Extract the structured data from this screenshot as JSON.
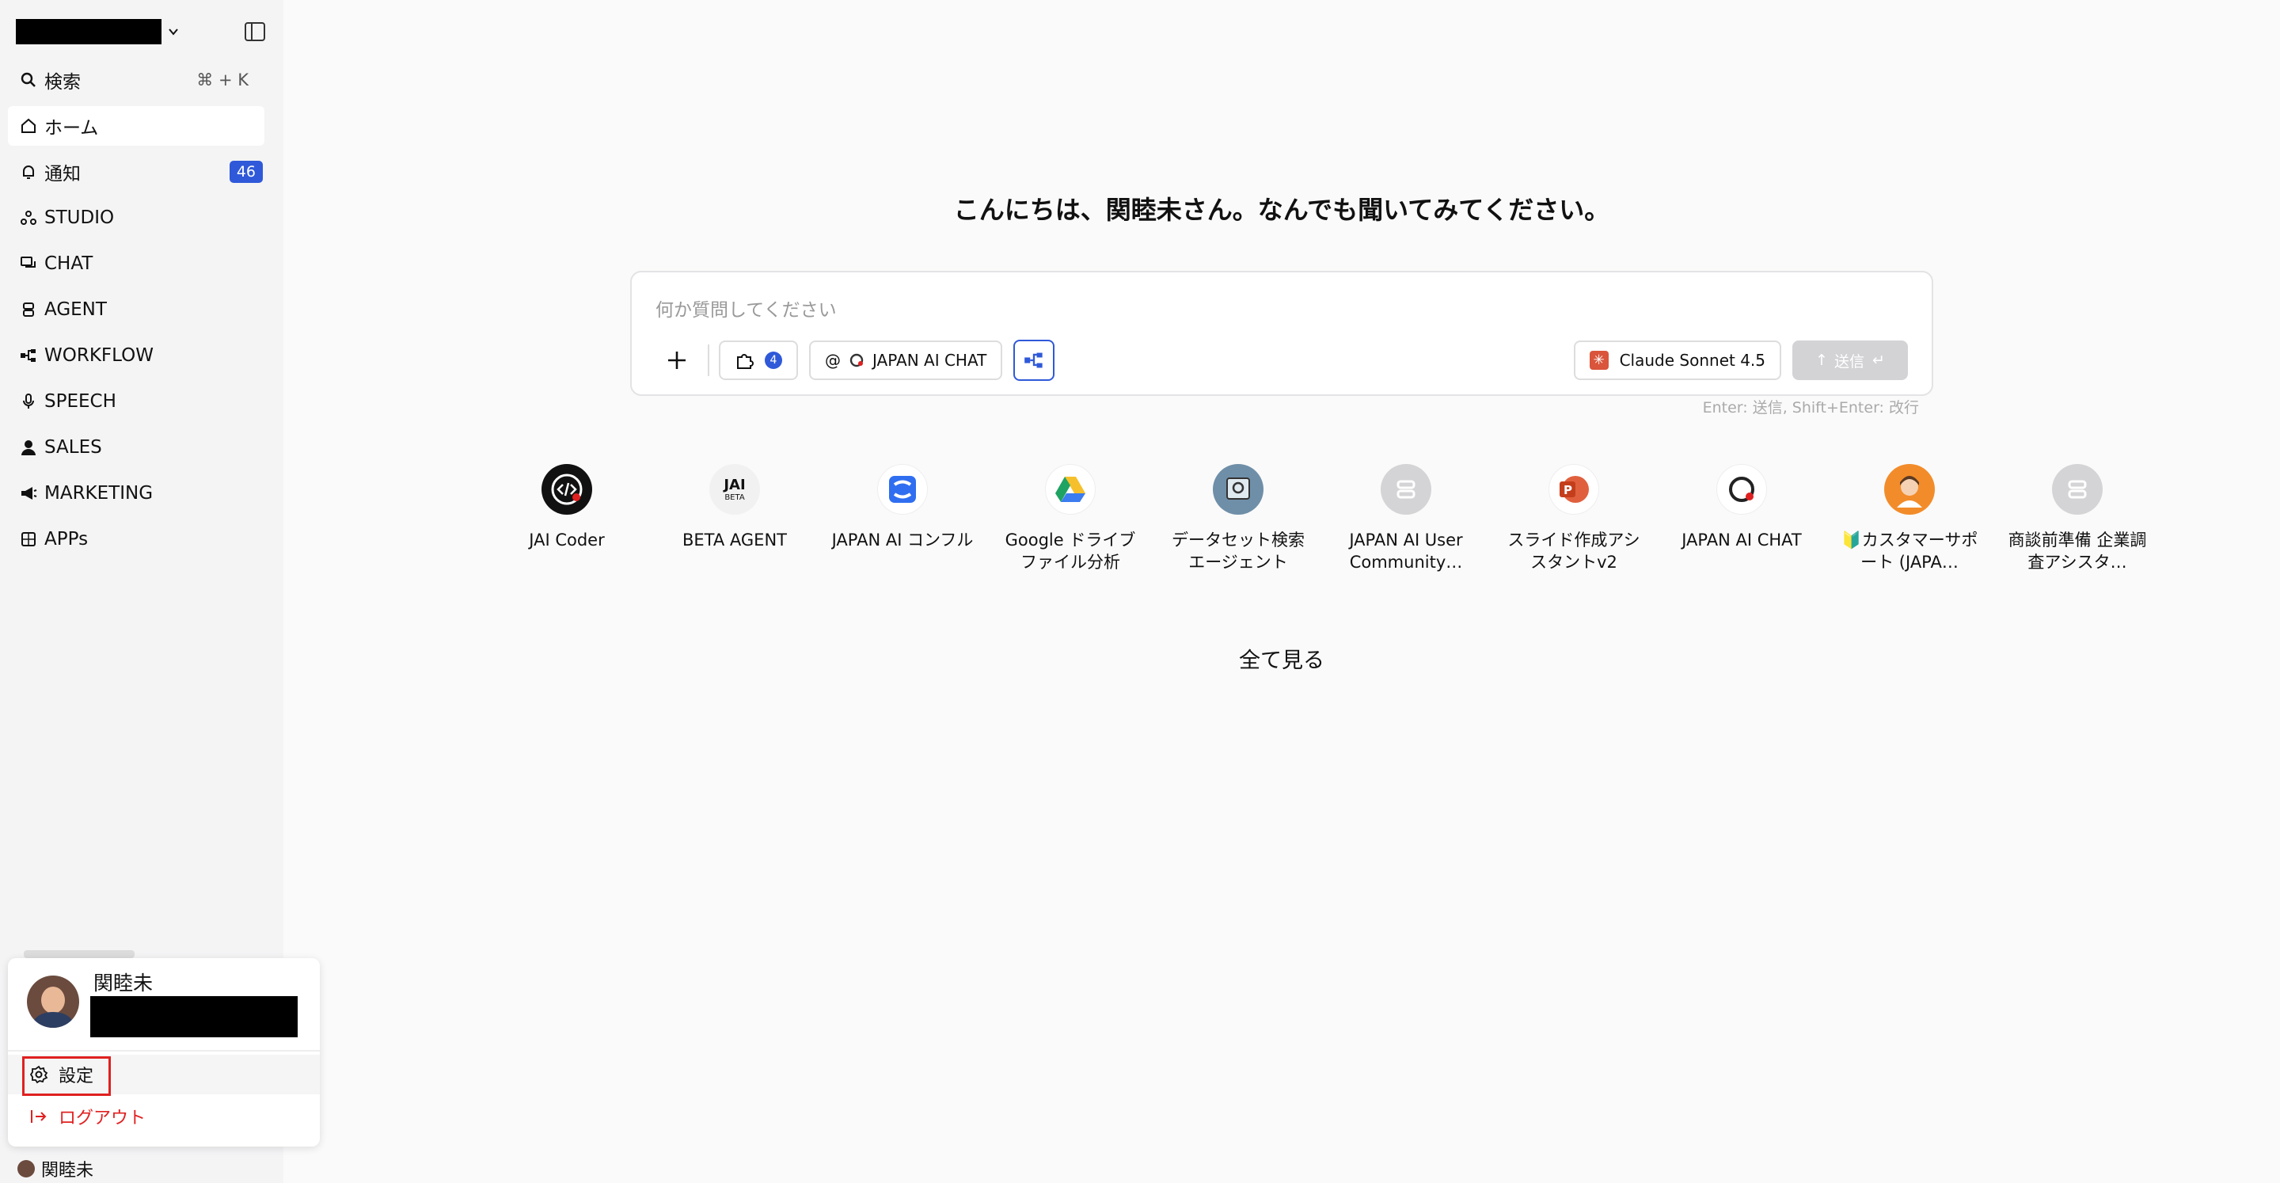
{
  "sidebar": {
    "items": [
      {
        "label": "検索",
        "icon": "search-icon",
        "shortcut": "⌘ + K"
      },
      {
        "label": "ホーム",
        "icon": "home-icon"
      },
      {
        "label": "通知",
        "icon": "bell-icon",
        "badge": "46"
      },
      {
        "label": "STUDIO",
        "icon": "studio-icon"
      },
      {
        "label": "CHAT",
        "icon": "chat-icon"
      },
      {
        "label": "AGENT",
        "icon": "agent-icon"
      },
      {
        "label": "WORKFLOW",
        "icon": "workflow-icon"
      },
      {
        "label": "SPEECH",
        "icon": "mic-icon"
      },
      {
        "label": "SALES",
        "icon": "person-icon"
      },
      {
        "label": "MARKETING",
        "icon": "megaphone-icon"
      },
      {
        "label": "APPs",
        "icon": "apps-icon"
      }
    ]
  },
  "main": {
    "greeting": "こんにちは、関睦未さん。なんでも聞いてみてください。",
    "composer": {
      "placeholder": "何か質問してください",
      "plugin_count": "4",
      "mention_label": "JAPAN AI CHAT",
      "mention_prefix": "@",
      "model_label": "Claude Sonnet 4.5",
      "send_label": "送信",
      "hint": "Enter: 送信, Shift+Enter: 改行"
    },
    "agents": [
      {
        "label": "JAI Coder",
        "icon": "code-icon"
      },
      {
        "label": "BETA AGENT",
        "icon": "jai-beta-icon"
      },
      {
        "label": "JAPAN AI コンフル",
        "icon": "confluence-icon"
      },
      {
        "label": "Google ドライブファイル分析",
        "icon": "google-drive-icon"
      },
      {
        "label": "データセット検索エージェント",
        "icon": "dataset-icon"
      },
      {
        "label": "JAPAN AI User Community…",
        "icon": "robot-icon"
      },
      {
        "label": "スライド作成アシスタントv2",
        "icon": "powerpoint-icon"
      },
      {
        "label": "JAPAN AI CHAT",
        "icon": "japan-ai-chat-icon"
      },
      {
        "label": "🔰カスタマーサポート (JAPA…",
        "icon": "support-avatar-icon"
      },
      {
        "label": "商談前準備 企業調査アシスタ…",
        "icon": "robot-icon"
      }
    ],
    "see_all": "全て見る"
  },
  "user_menu": {
    "name": "関睦未",
    "settings_label": "設定",
    "logout_label": "ログアウト"
  },
  "footer_user": {
    "name": "関睦未"
  },
  "colors": {
    "accent": "#2f59d9",
    "danger": "#e02020",
    "sidebar_bg": "#f4f4f5"
  }
}
